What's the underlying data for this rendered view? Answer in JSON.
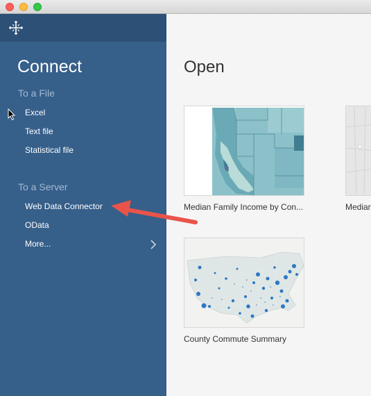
{
  "window": {
    "controls": [
      "close",
      "minimize",
      "zoom"
    ]
  },
  "sidebar": {
    "logo_icon": "tableau-logo-icon",
    "title": "Connect",
    "to_a_file": {
      "label": "To a File",
      "items": [
        {
          "label": "Excel"
        },
        {
          "label": "Text file"
        },
        {
          "label": "Statistical file"
        }
      ]
    },
    "to_a_server": {
      "label": "To a Server",
      "items": [
        {
          "label": "Web Data Connector"
        },
        {
          "label": "OData"
        },
        {
          "label": "More..."
        }
      ]
    },
    "more_icon": "chevron-right-icon"
  },
  "main": {
    "title": "Open",
    "workbooks": [
      {
        "label": "Median Family Income by Con...",
        "thumbnail": "us-west-choropleth-map"
      },
      {
        "label": "Median",
        "thumbnail": "grey-map"
      },
      {
        "label": "County Commute Summary",
        "thumbnail": "us-bubble-map"
      }
    ]
  },
  "annotation": {
    "arrow_color": "#e8544a",
    "points_to": "Web Data Connector"
  },
  "colors": {
    "sidebar_bg": "#365f8a",
    "sidebar_header_bg": "#2d5076",
    "section_label": "#a3bbd3"
  }
}
